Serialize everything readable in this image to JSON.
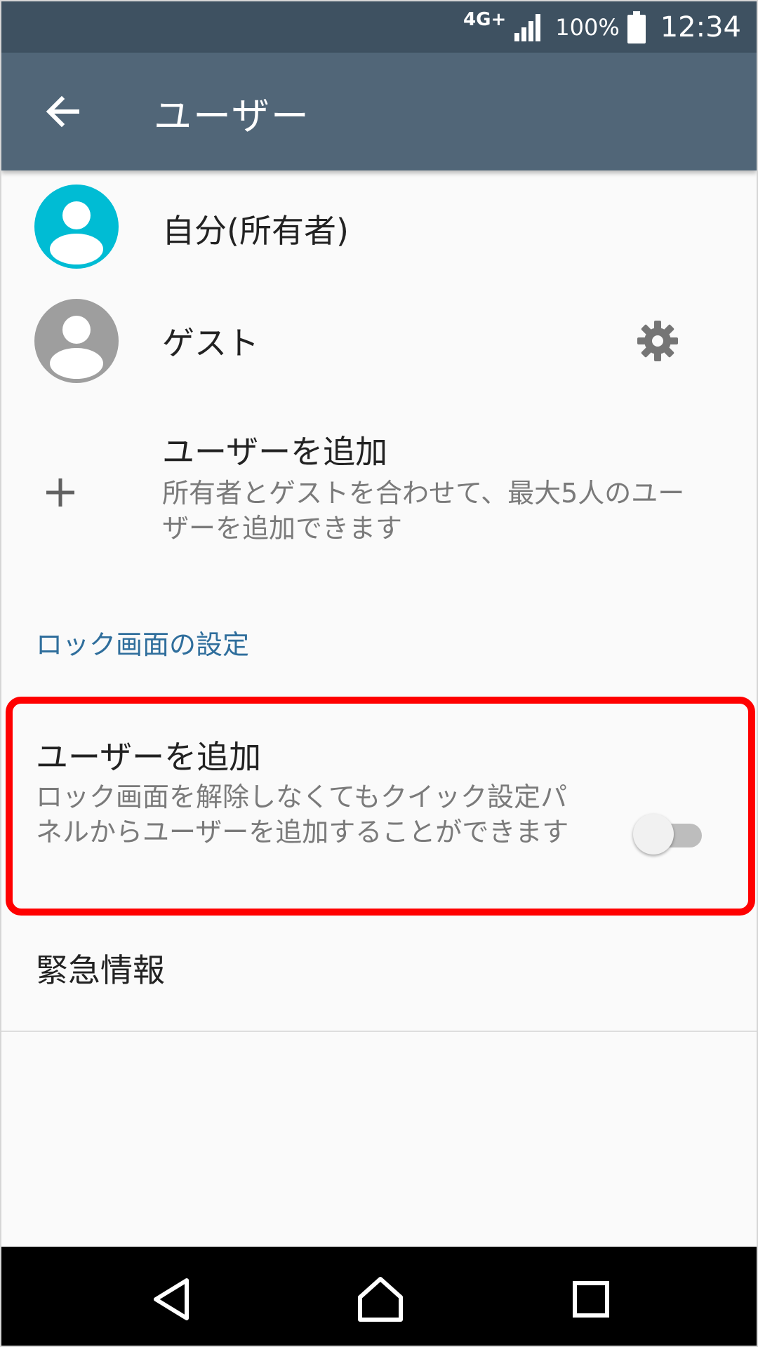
{
  "status_bar": {
    "network": "4G+",
    "battery": "100%",
    "time": "12:34"
  },
  "app_bar": {
    "title": "ユーザー"
  },
  "users": [
    {
      "label": "自分(所有者)",
      "avatar_color": "#00bcd4"
    },
    {
      "label": "ゲスト",
      "avatar_color": "#9e9e9e"
    }
  ],
  "add_user": {
    "title": "ユーザーを追加",
    "description": "所有者とゲストを合わせて、最大5人のユーザーを追加できます"
  },
  "lock_screen_section": {
    "header": "ロック画面の設定",
    "add_user_title": "ユーザーを追加",
    "add_user_description": "ロック画面を解除しなくてもクイック設定パネルからユーザーを追加することができます",
    "toggle_on": false
  },
  "emergency_info": {
    "label": "緊急情報"
  },
  "colors": {
    "status_bar": "#3e5161",
    "app_bar": "#516678",
    "section_header": "#2f6e9c",
    "highlight": "#ff0000"
  },
  "icons": {
    "back": "arrow-left-icon",
    "gear": "gear-icon",
    "plus": "plus-icon",
    "nav_back": "triangle-back-icon",
    "nav_home": "home-icon",
    "nav_recents": "square-recents-icon"
  }
}
